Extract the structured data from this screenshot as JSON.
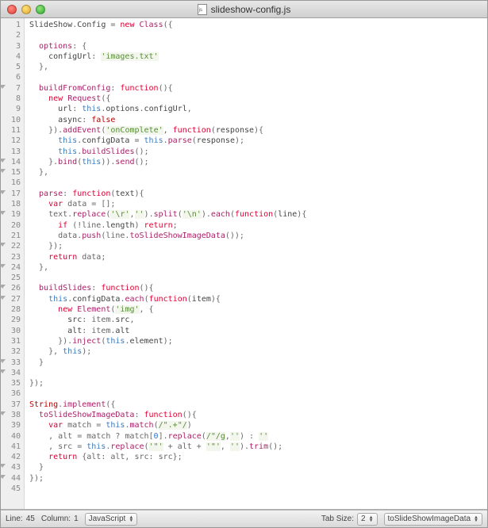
{
  "window": {
    "title": "slideshow-config.js"
  },
  "status": {
    "line_label": "Line:",
    "line_value": "45",
    "col_label": "Column:",
    "col_value": "1",
    "language": "JavaScript",
    "tabsize_label": "Tab Size:",
    "tabsize_value": "2",
    "symbol": "toSlideShowImageData"
  },
  "gutter": {
    "lines": 45,
    "fold_triangles": [
      7,
      14,
      15,
      17,
      19,
      22,
      24,
      26,
      27,
      33,
      34,
      38,
      43,
      44
    ]
  },
  "code_tokens": [
    [
      [
        "SlideShow",
        "t-prop"
      ],
      [
        ".",
        "t-punc"
      ],
      [
        "Config",
        "t-prop"
      ],
      [
        " = ",
        "t-punc"
      ],
      [
        "new",
        "t-kw"
      ],
      [
        " ",
        ""
      ],
      [
        "Class",
        "t-method"
      ],
      [
        "({",
        "t-punc"
      ]
    ],
    [],
    [
      [
        "  options",
        "t-fnname"
      ],
      [
        ": {",
        "t-punc"
      ]
    ],
    [
      [
        "    configUrl",
        "t-prop"
      ],
      [
        ": ",
        "t-punc"
      ],
      [
        "'images.txt'",
        "t-str"
      ]
    ],
    [
      [
        "  },",
        "t-punc"
      ]
    ],
    [],
    [
      [
        "  buildFromConfig",
        "t-fnname"
      ],
      [
        ": ",
        "t-punc"
      ],
      [
        "function",
        "t-kw"
      ],
      [
        "(){",
        "t-punc"
      ]
    ],
    [
      [
        "    ",
        ""
      ],
      [
        "new",
        "t-kw"
      ],
      [
        " ",
        ""
      ],
      [
        "Request",
        "t-method"
      ],
      [
        "({",
        "t-punc"
      ]
    ],
    [
      [
        "      url",
        "t-prop"
      ],
      [
        ": ",
        "t-punc"
      ],
      [
        "this",
        "t-this"
      ],
      [
        ".",
        "t-punc"
      ],
      [
        "options",
        "t-prop"
      ],
      [
        ".",
        "t-punc"
      ],
      [
        "configUrl",
        "t-prop"
      ],
      [
        ",",
        "t-punc"
      ]
    ],
    [
      [
        "      async",
        "t-prop"
      ],
      [
        ": ",
        "t-punc"
      ],
      [
        "false",
        "t-const"
      ]
    ],
    [
      [
        "    }).",
        "t-punc"
      ],
      [
        "addEvent",
        "t-method"
      ],
      [
        "(",
        "t-punc"
      ],
      [
        "'onComplete'",
        "t-str"
      ],
      [
        ", ",
        "t-punc"
      ],
      [
        "function",
        "t-kw"
      ],
      [
        "(",
        "t-punc"
      ],
      [
        "response",
        "t-prop"
      ],
      [
        "){",
        "t-punc"
      ]
    ],
    [
      [
        "      ",
        ""
      ],
      [
        "this",
        "t-this"
      ],
      [
        ".",
        "t-punc"
      ],
      [
        "configData",
        "t-prop"
      ],
      [
        " = ",
        "t-punc"
      ],
      [
        "this",
        "t-this"
      ],
      [
        ".",
        "t-punc"
      ],
      [
        "parse",
        "t-method"
      ],
      [
        "(",
        "t-punc"
      ],
      [
        "response",
        "t-prop"
      ],
      [
        ");",
        "t-punc"
      ]
    ],
    [
      [
        "      ",
        ""
      ],
      [
        "this",
        "t-this"
      ],
      [
        ".",
        "t-punc"
      ],
      [
        "buildSlides",
        "t-method"
      ],
      [
        "();",
        "t-punc"
      ]
    ],
    [
      [
        "    }.",
        "t-punc"
      ],
      [
        "bind",
        "t-method"
      ],
      [
        "(",
        "t-punc"
      ],
      [
        "this",
        "t-this"
      ],
      [
        ")).",
        "t-punc"
      ],
      [
        "send",
        "t-method"
      ],
      [
        "();",
        "t-punc"
      ]
    ],
    [
      [
        "  },",
        "t-punc"
      ]
    ],
    [],
    [
      [
        "  parse",
        "t-fnname"
      ],
      [
        ": ",
        "t-punc"
      ],
      [
        "function",
        "t-kw"
      ],
      [
        "(",
        "t-punc"
      ],
      [
        "text",
        "t-prop"
      ],
      [
        "){",
        "t-punc"
      ]
    ],
    [
      [
        "    ",
        ""
      ],
      [
        "var",
        "t-kw"
      ],
      [
        " data = [];",
        "t-punc"
      ]
    ],
    [
      [
        "    text.",
        "t-punc"
      ],
      [
        "replace",
        "t-method"
      ],
      [
        "(",
        "t-punc"
      ],
      [
        "'\\r'",
        "t-str"
      ],
      [
        ",",
        "t-punc"
      ],
      [
        "''",
        "t-str"
      ],
      [
        ").",
        "t-punc"
      ],
      [
        "split",
        "t-method"
      ],
      [
        "(",
        "t-punc"
      ],
      [
        "'\\n'",
        "t-str"
      ],
      [
        ").",
        "t-punc"
      ],
      [
        "each",
        "t-method"
      ],
      [
        "(",
        "t-punc"
      ],
      [
        "function",
        "t-kw"
      ],
      [
        "(",
        "t-punc"
      ],
      [
        "line",
        "t-prop"
      ],
      [
        "){",
        "t-punc"
      ]
    ],
    [
      [
        "      ",
        ""
      ],
      [
        "if",
        "t-kw"
      ],
      [
        " (!line.",
        "t-punc"
      ],
      [
        "length",
        "t-prop"
      ],
      [
        ") ",
        "t-punc"
      ],
      [
        "return",
        "t-kw"
      ],
      [
        ";",
        "t-punc"
      ]
    ],
    [
      [
        "      data.",
        "t-punc"
      ],
      [
        "push",
        "t-method"
      ],
      [
        "(line.",
        "t-punc"
      ],
      [
        "toSlideShowImageData",
        "t-method"
      ],
      [
        "());",
        "t-punc"
      ]
    ],
    [
      [
        "    });",
        "t-punc"
      ]
    ],
    [
      [
        "    ",
        ""
      ],
      [
        "return",
        "t-kw"
      ],
      [
        " data;",
        "t-punc"
      ]
    ],
    [
      [
        "  },",
        "t-punc"
      ]
    ],
    [],
    [
      [
        "  buildSlides",
        "t-fnname"
      ],
      [
        ": ",
        "t-punc"
      ],
      [
        "function",
        "t-kw"
      ],
      [
        "(){",
        "t-punc"
      ]
    ],
    [
      [
        "    ",
        ""
      ],
      [
        "this",
        "t-this"
      ],
      [
        ".",
        "t-punc"
      ],
      [
        "configData",
        "t-prop"
      ],
      [
        ".",
        "t-punc"
      ],
      [
        "each",
        "t-method"
      ],
      [
        "(",
        "t-punc"
      ],
      [
        "function",
        "t-kw"
      ],
      [
        "(",
        "t-punc"
      ],
      [
        "item",
        "t-prop"
      ],
      [
        "){",
        "t-punc"
      ]
    ],
    [
      [
        "      ",
        ""
      ],
      [
        "new",
        "t-kw"
      ],
      [
        " ",
        ""
      ],
      [
        "Element",
        "t-method"
      ],
      [
        "(",
        "t-punc"
      ],
      [
        "'img'",
        "t-str"
      ],
      [
        ", {",
        "t-punc"
      ]
    ],
    [
      [
        "        src",
        "t-prop"
      ],
      [
        ": item.",
        "t-punc"
      ],
      [
        "src",
        "t-prop"
      ],
      [
        ",",
        "t-punc"
      ]
    ],
    [
      [
        "        alt",
        "t-prop"
      ],
      [
        ": item.",
        "t-punc"
      ],
      [
        "alt",
        "t-prop"
      ]
    ],
    [
      [
        "      }).",
        "t-punc"
      ],
      [
        "inject",
        "t-method"
      ],
      [
        "(",
        "t-punc"
      ],
      [
        "this",
        "t-this"
      ],
      [
        ".",
        "t-punc"
      ],
      [
        "element",
        "t-prop"
      ],
      [
        ");",
        "t-punc"
      ]
    ],
    [
      [
        "    }, ",
        "t-punc"
      ],
      [
        "this",
        "t-this"
      ],
      [
        ");",
        "t-punc"
      ]
    ],
    [
      [
        "  }",
        "t-punc"
      ]
    ],
    [],
    [
      [
        "});",
        "t-punc"
      ]
    ],
    [],
    [
      [
        "String",
        "t-const"
      ],
      [
        ".",
        "t-punc"
      ],
      [
        "implement",
        "t-method"
      ],
      [
        "({",
        "t-punc"
      ]
    ],
    [
      [
        "  toSlideShowImageData",
        "t-fnname"
      ],
      [
        ": ",
        "t-punc"
      ],
      [
        "function",
        "t-kw"
      ],
      [
        "(){",
        "t-punc"
      ]
    ],
    [
      [
        "    ",
        ""
      ],
      [
        "var",
        "t-kw"
      ],
      [
        " match = ",
        "t-punc"
      ],
      [
        "this",
        "t-this"
      ],
      [
        ".",
        "t-punc"
      ],
      [
        "match",
        "t-method"
      ],
      [
        "(",
        "t-punc"
      ],
      [
        "/\".+\"/",
        "t-str"
      ],
      [
        ")",
        "t-punc"
      ]
    ],
    [
      [
        "    , alt = match ? match[",
        "t-punc"
      ],
      [
        "0",
        "t-num"
      ],
      [
        "].",
        "t-punc"
      ],
      [
        "replace",
        "t-method"
      ],
      [
        "(",
        "t-punc"
      ],
      [
        "/\"/g",
        "t-str"
      ],
      [
        ",",
        "t-punc"
      ],
      [
        "''",
        "t-str"
      ],
      [
        ") : ",
        "t-punc"
      ],
      [
        "''",
        "t-str"
      ]
    ],
    [
      [
        "    , src = ",
        "t-punc"
      ],
      [
        "this",
        "t-this"
      ],
      [
        ".",
        "t-punc"
      ],
      [
        "replace",
        "t-method"
      ],
      [
        "(",
        "t-punc"
      ],
      [
        "'\"'",
        "t-str"
      ],
      [
        " + alt + ",
        "t-punc"
      ],
      [
        "'\"'",
        "t-str"
      ],
      [
        ", ",
        "t-punc"
      ],
      [
        "''",
        "t-str"
      ],
      [
        ").",
        "t-punc"
      ],
      [
        "trim",
        "t-method"
      ],
      [
        "();",
        "t-punc"
      ]
    ],
    [
      [
        "    ",
        ""
      ],
      [
        "return",
        "t-kw"
      ],
      [
        " {alt: alt, src: src};",
        "t-punc"
      ]
    ],
    [
      [
        "  }",
        "t-punc"
      ]
    ],
    [
      [
        "});",
        "t-punc"
      ]
    ],
    []
  ]
}
